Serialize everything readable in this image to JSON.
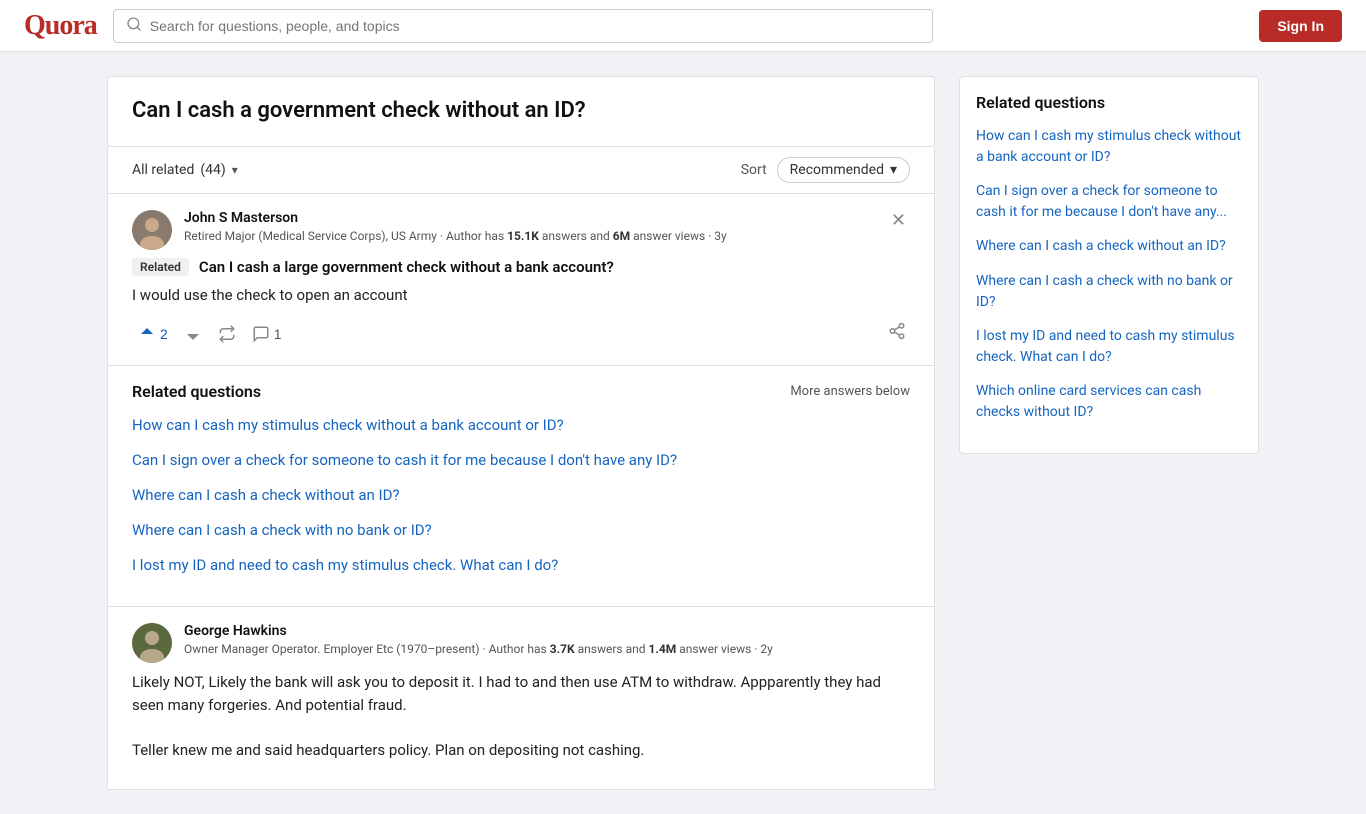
{
  "header": {
    "logo": "Quora",
    "search_placeholder": "Search for questions, people, and topics",
    "sign_in_label": "Sign In"
  },
  "question": {
    "title": "Can I cash a government check without an ID?"
  },
  "filter": {
    "all_related_label": "All related",
    "count": "(44)",
    "sort_label": "Sort",
    "sort_value": "Recommended",
    "chevron": "▾"
  },
  "answers": [
    {
      "id": "john",
      "author_name": "John S Masterson",
      "author_bio_prefix": "Retired Major (Medical Service Corps), US Army · Author has ",
      "author_answers": "15.1K",
      "author_bio_mid": " answers and ",
      "author_views": "6M",
      "author_bio_suffix": " answer views ·",
      "time_ago": "3y",
      "related_tag": "Related",
      "related_question": "Can I cash a large government check without a bank account?",
      "answer_text": "I would use the check to open an account",
      "upvotes": 2,
      "comments": 1
    },
    {
      "id": "george",
      "author_name": "George Hawkins",
      "author_bio_prefix": "Owner Manager Operator. Employer Etc (1970–present) · Author has ",
      "author_answers": "3.7K",
      "author_bio_mid": " answers and ",
      "author_views": "1.4M",
      "author_bio_suffix": " answer views ·",
      "time_ago": "2y",
      "answer_text": "Likely NOT, Likely the bank will ask you to deposit it. I had to and then use ATM to withdraw. Appparently they had seen many forgeries. And potential fraud.\n\nTeller knew me and said headquarters policy. Plan on depositing not cashing."
    }
  ],
  "related_questions_inline": {
    "title": "Related questions",
    "more_answers_label": "More answers below",
    "questions": [
      "How can I cash my stimulus check without a bank account or ID?",
      "Can I sign over a check for someone to cash it for me because I don't have any ID?",
      "Where can I cash a check without an ID?",
      "Where can I cash a check with no bank or ID?",
      "I lost my ID and need to cash my stimulus check. What can I do?"
    ]
  },
  "sidebar": {
    "title": "Related questions",
    "questions": [
      "How can I cash my stimulus check without a bank account or ID?",
      "Can I sign over a check for someone to cash it for me because I don't have any...",
      "Where can I cash a check without an ID?",
      "Where can I cash a check with no bank or ID?",
      "I lost my ID and need to cash my stimulus check. What can I do?",
      "Which online card services can cash checks without ID?"
    ]
  }
}
